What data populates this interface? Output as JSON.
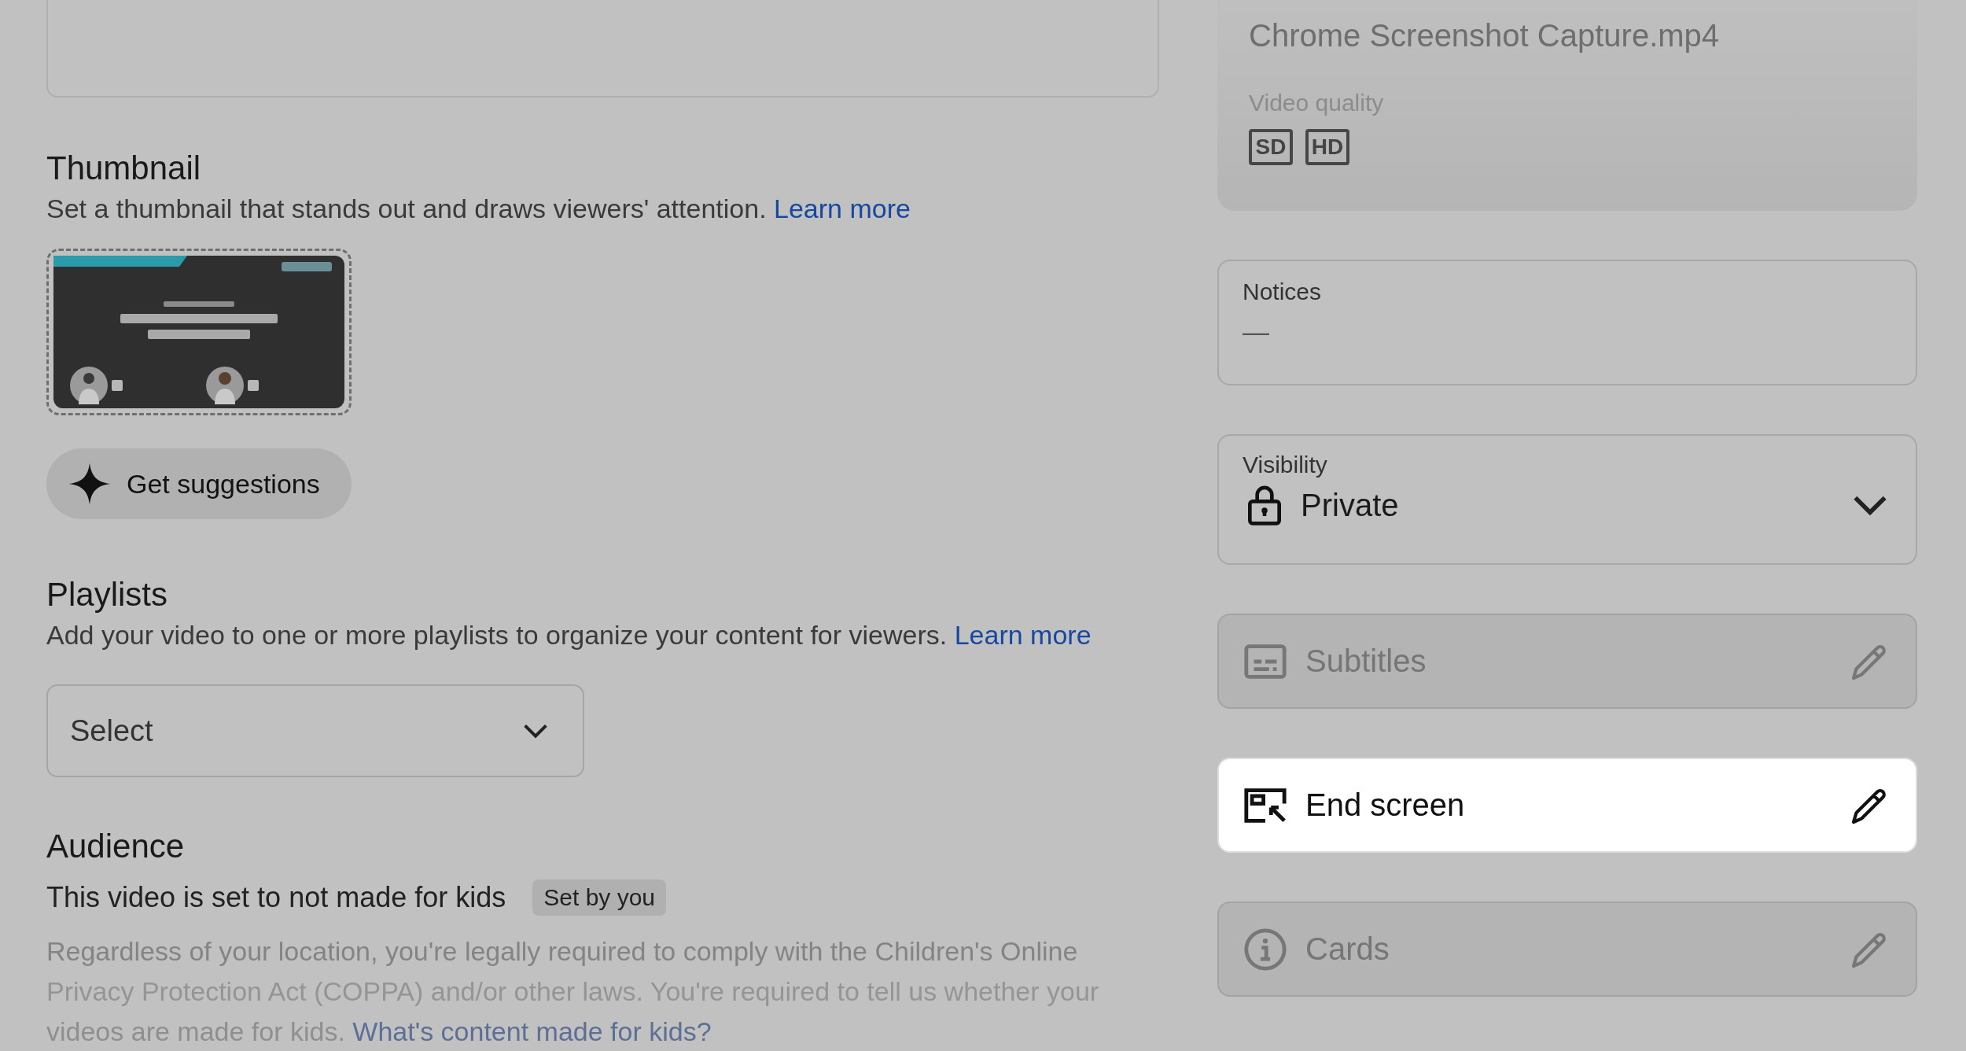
{
  "details": {
    "thumbnail": {
      "heading": "Thumbnail",
      "description": "Set a thumbnail that stands out and draws viewers' attention.",
      "link": "Learn more",
      "suggest_button": "Get suggestions"
    },
    "playlists": {
      "heading": "Playlists",
      "description": "Add your video to one or more playlists to organize your content for viewers.",
      "link": "Learn more",
      "dropdown": "Select"
    },
    "audience": {
      "heading": "Audience",
      "status": "This video is set to not made for kids",
      "chip": "Set by you",
      "lines": [
        "Regardless of your location, you're legally required to comply with the Children's Online",
        "Privacy Protection Act (COPPA) and/or other laws. You're required to tell us whether your"
      ],
      "last_line": "videos are made for kids.",
      "last_link": "What's content made for kids?"
    }
  },
  "sidebar": {
    "file": {
      "filename": "Chrome Screenshot Capture.mp4",
      "quality_label": "Video quality",
      "quality_badges": [
        "SD",
        "HD"
      ]
    },
    "notices": {
      "label": "Notices",
      "value": "—"
    },
    "visibility": {
      "label": "Visibility",
      "value": "Private"
    },
    "actions": [
      {
        "kind": "subtitles",
        "label": "Subtitles",
        "highlighted": false
      },
      {
        "kind": "end_screen",
        "label": "End screen",
        "highlighted": true
      },
      {
        "kind": "cards",
        "label": "Cards",
        "highlighted": false
      }
    ]
  }
}
